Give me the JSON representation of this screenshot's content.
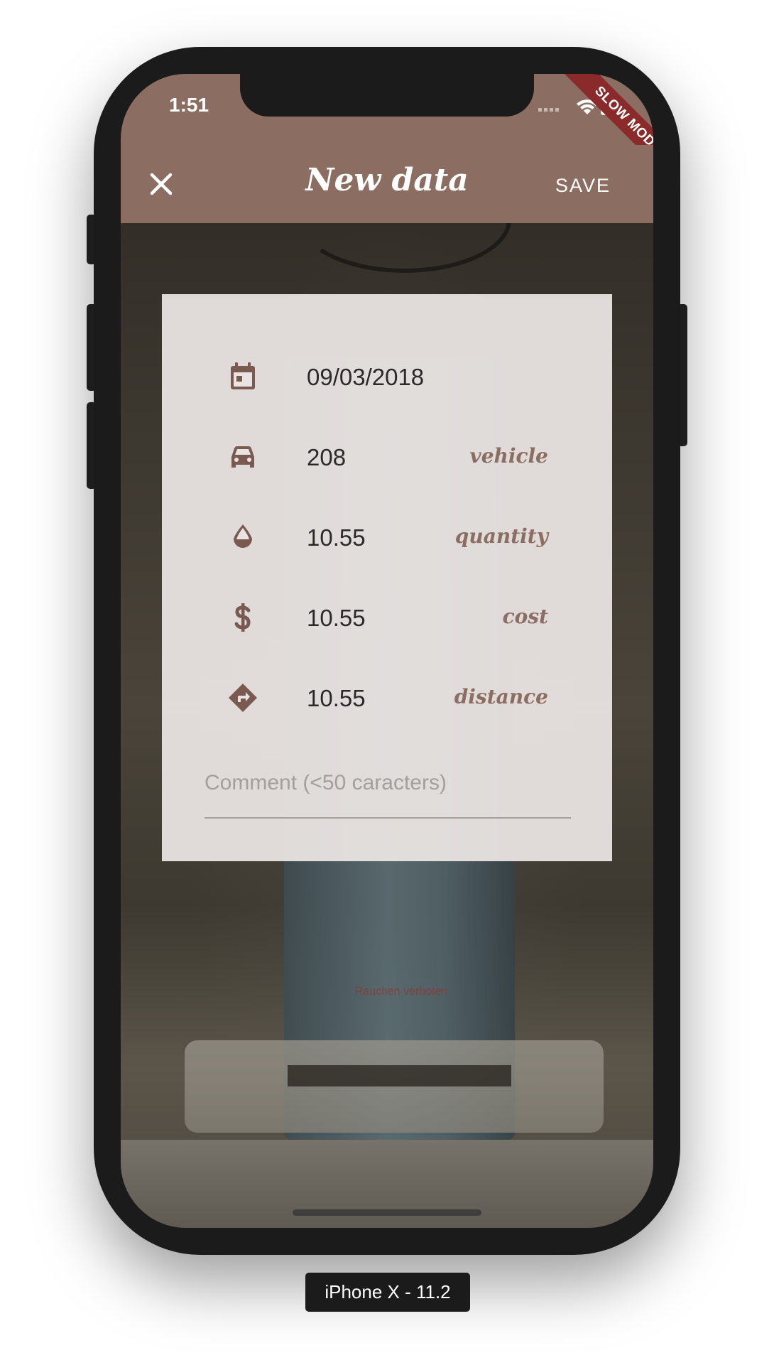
{
  "status_bar": {
    "time": "1:51",
    "icons": [
      "signal-icon",
      "wifi-icon",
      "battery-icon"
    ],
    "debug_banner": "SLOW MODE"
  },
  "app_bar": {
    "close_icon": "close-icon",
    "title": "New data",
    "save_label": "SAVE",
    "color": "#8b6d62"
  },
  "form": {
    "fields": [
      {
        "icon": "calendar-icon",
        "value": "09/03/2018",
        "tag": ""
      },
      {
        "icon": "car-icon",
        "value": "208",
        "tag": "vehicle"
      },
      {
        "icon": "drop-icon",
        "value": "10.55",
        "tag": "quantity"
      },
      {
        "icon": "dollar-icon",
        "value": "10.55",
        "tag": "cost"
      },
      {
        "icon": "directions-icon",
        "value": "10.55",
        "tag": "distance"
      }
    ],
    "comment": {
      "value": "",
      "placeholder": "Comment (<50 caracters)"
    }
  },
  "background": {
    "pump_text": "Rauchen verboten"
  },
  "device_label": "iPhone X - 11.2"
}
